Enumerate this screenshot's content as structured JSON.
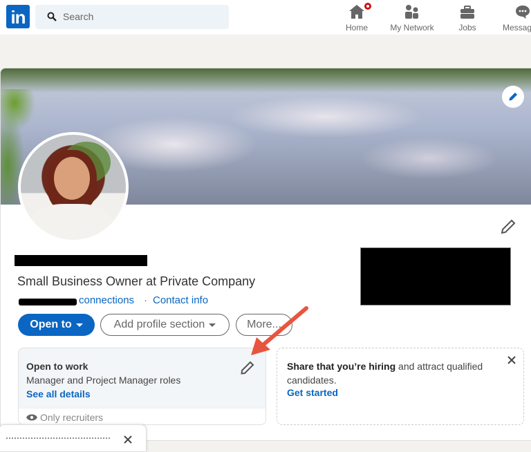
{
  "topbar": {
    "logo": "in",
    "search_placeholder": "Search",
    "nav": [
      {
        "label": "Home",
        "icon": "home-icon",
        "has_notification": true
      },
      {
        "label": "My Network",
        "icon": "network-icon"
      },
      {
        "label": "Jobs",
        "icon": "briefcase-icon"
      },
      {
        "label": "Messag",
        "icon": "messaging-icon"
      }
    ]
  },
  "profile": {
    "name": "[redacted]",
    "headline": "Small Business Owner at Private Company",
    "connections_label": "connections",
    "separator": "·",
    "contact_info": "Contact info",
    "buttons": {
      "open_to": "Open to",
      "add_section": "Add profile section",
      "more": "More..."
    }
  },
  "open_to_work": {
    "title": "Open to work",
    "roles": "Manager and Project Manager roles",
    "link": "See all details",
    "visibility": "Only recruiters"
  },
  "hiring": {
    "bold": "Share that you’re hiring",
    "rest": " and attract qualified candidates.",
    "link": "Get started"
  },
  "colors": {
    "brand": "#0a66c2",
    "annotation_arrow": "#e8553f",
    "notification": "#cc1016"
  }
}
